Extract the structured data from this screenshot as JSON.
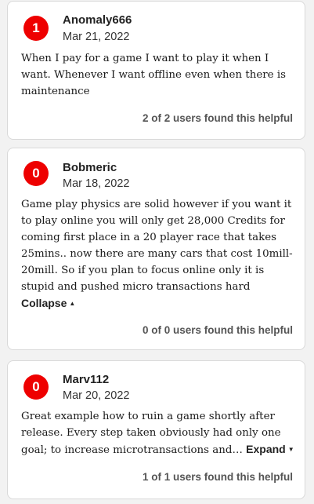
{
  "reviews": [
    {
      "score": "1",
      "username": "Anomaly666",
      "date": "Mar 21, 2022",
      "text": "When I pay for a game I want to play it when I want. Whenever I want offline even when there is maintenance",
      "helpful": "2 of 2 users found this helpful"
    },
    {
      "score": "0",
      "username": "Bobmeric",
      "date": "Mar 18, 2022",
      "text": "Game play physics are solid however if you want it to play online you will only get 28,000 Credits for coming first place in a 20 player race that takes 25mins.. now there are many cars that cost 10mill-20mill. So if you plan to focus online only it is stupid and pushed micro transactions hard",
      "toggle_label": "Collapse",
      "toggle_icon": "caret-up-icon",
      "helpful": "0 of 0 users found this helpful"
    },
    {
      "score": "0",
      "username": "Marv112",
      "date": "Mar 20, 2022",
      "text": "Great example how to ruin a game shortly after release. Every step taken obviously had only one goal; to increase microtransactions and…",
      "toggle_label": "Expand",
      "toggle_icon": "caret-down-icon",
      "helpful": "1 of 1 users found this helpful"
    }
  ],
  "colors": {
    "score_badge": "#ee0000",
    "card_background": "#ffffff",
    "page_background": "#f2f2f2"
  }
}
